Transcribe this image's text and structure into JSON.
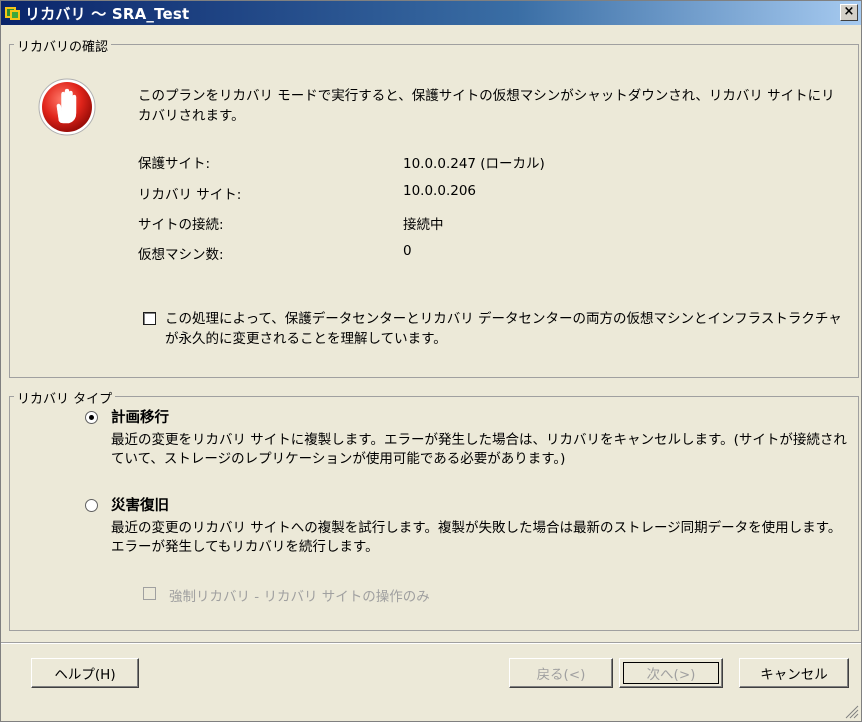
{
  "window": {
    "title": "リカバリ ～ SRA_Test",
    "close_label": "×"
  },
  "confirm": {
    "group_title": "リカバリの確認",
    "message": "このプランをリカバリ モードで実行すると、保護サイトの仮想マシンがシャットダウンされ、リカバリ サイトにリカバリされます。",
    "rows": [
      {
        "label": "保護サイト:",
        "value": "10.0.0.247 (ローカル)"
      },
      {
        "label": "リカバリ サイト:",
        "value": "10.0.0.206"
      },
      {
        "label": "サイトの接続:",
        "value": "接続中"
      },
      {
        "label": "仮想マシン数:",
        "value": "0"
      }
    ],
    "ack_checked": false,
    "ack_text": "この処理によって、保護データセンターとリカバリ データセンターの両方の仮想マシンとインフラストラクチャが永久的に変更されることを理解しています。"
  },
  "recovery_type": {
    "group_title": "リカバリ タイプ",
    "options": [
      {
        "title": "計画移行",
        "desc": "最近の変更をリカバリ サイトに複製します。エラーが発生した場合は、リカバリをキャンセルします。(サイトが接続されていて、ストレージのレプリケーションが使用可能である必要があります。)",
        "selected": true
      },
      {
        "title": "災害復旧",
        "desc": "最近の変更のリカバリ サイトへの複製を試行します。複製が失敗した場合は最新のストレージ同期データを使用します。エラーが発生してもリカバリを続行します。",
        "selected": false
      }
    ],
    "forced_label": "強制リカバリ - リカバリ サイトの操作のみ",
    "forced_checked": false
  },
  "buttons": {
    "help": "ヘルプ(H)",
    "back": "戻る(<)",
    "next": "次へ(>)",
    "cancel": "キャンセル"
  }
}
